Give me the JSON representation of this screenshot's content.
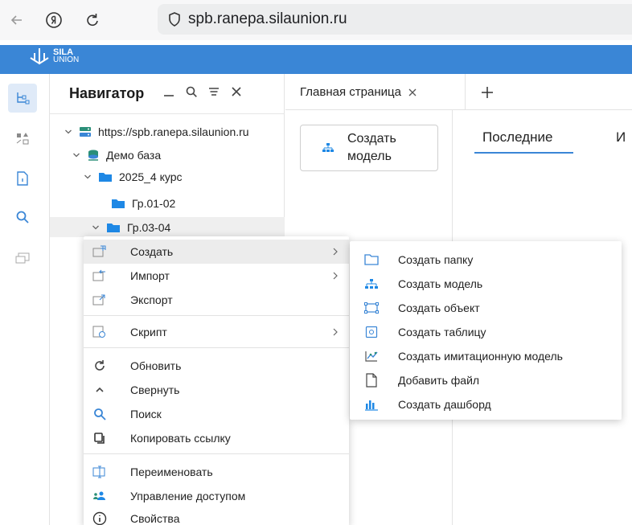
{
  "browser": {
    "url": "spb.ranepa.silaunion.ru",
    "back_icon": "arrow-left-icon",
    "yandex_icon": "yandex-icon",
    "reload_icon": "reload-icon",
    "shield_icon": "shield-icon"
  },
  "app": {
    "logo_line1": "SILA",
    "logo_line2": "UNION",
    "accent_color": "#3a86d6"
  },
  "navigator": {
    "title": "Навигатор",
    "tree": [
      {
        "label": "https://spb.ranepa.silaunion.ru",
        "icon": "server-icon"
      },
      {
        "label": "Демо база",
        "icon": "database-icon"
      },
      {
        "label": "2025_4 курс",
        "icon": "folder-icon"
      },
      {
        "label": "Гр.01-02",
        "icon": "folder-icon"
      },
      {
        "label": "Гр.03-04",
        "icon": "folder-icon"
      }
    ]
  },
  "tabs": {
    "main_tab": "Главная страница"
  },
  "content": {
    "create_model_label": "Создать модель",
    "tab_recent": "Последние",
    "tab_other": "И"
  },
  "context_menu": {
    "items": [
      {
        "label": "Создать",
        "icon": "create-icon",
        "submenu": true
      },
      {
        "label": "Импорт",
        "icon": "import-icon",
        "submenu": true
      },
      {
        "label": "Экспорт",
        "icon": "export-icon",
        "submenu": false
      },
      {
        "label": "Скрипт",
        "icon": "script-icon",
        "submenu": true
      },
      {
        "label": "Обновить",
        "icon": "refresh-icon",
        "submenu": false
      },
      {
        "label": "Свернуть",
        "icon": "collapse-icon",
        "submenu": false
      },
      {
        "label": "Поиск",
        "icon": "search-icon",
        "submenu": false
      },
      {
        "label": "Копировать ссылку",
        "icon": "copy-link-icon",
        "submenu": false
      },
      {
        "label": "Переименовать",
        "icon": "rename-icon",
        "submenu": false
      },
      {
        "label": "Управление доступом",
        "icon": "access-icon",
        "submenu": false
      },
      {
        "label": "Свойства",
        "icon": "info-icon",
        "submenu": false
      }
    ]
  },
  "submenu": {
    "items": [
      {
        "label": "Создать папку",
        "icon": "folder-outline-icon"
      },
      {
        "label": "Создать модель",
        "icon": "model-icon"
      },
      {
        "label": "Создать объект",
        "icon": "object-icon"
      },
      {
        "label": "Создать таблицу",
        "icon": "table-icon"
      },
      {
        "label": "Создать имитационную модель",
        "icon": "simulation-icon"
      },
      {
        "label": "Добавить файл",
        "icon": "file-icon"
      },
      {
        "label": "Создать дашборд",
        "icon": "dashboard-icon"
      }
    ]
  }
}
